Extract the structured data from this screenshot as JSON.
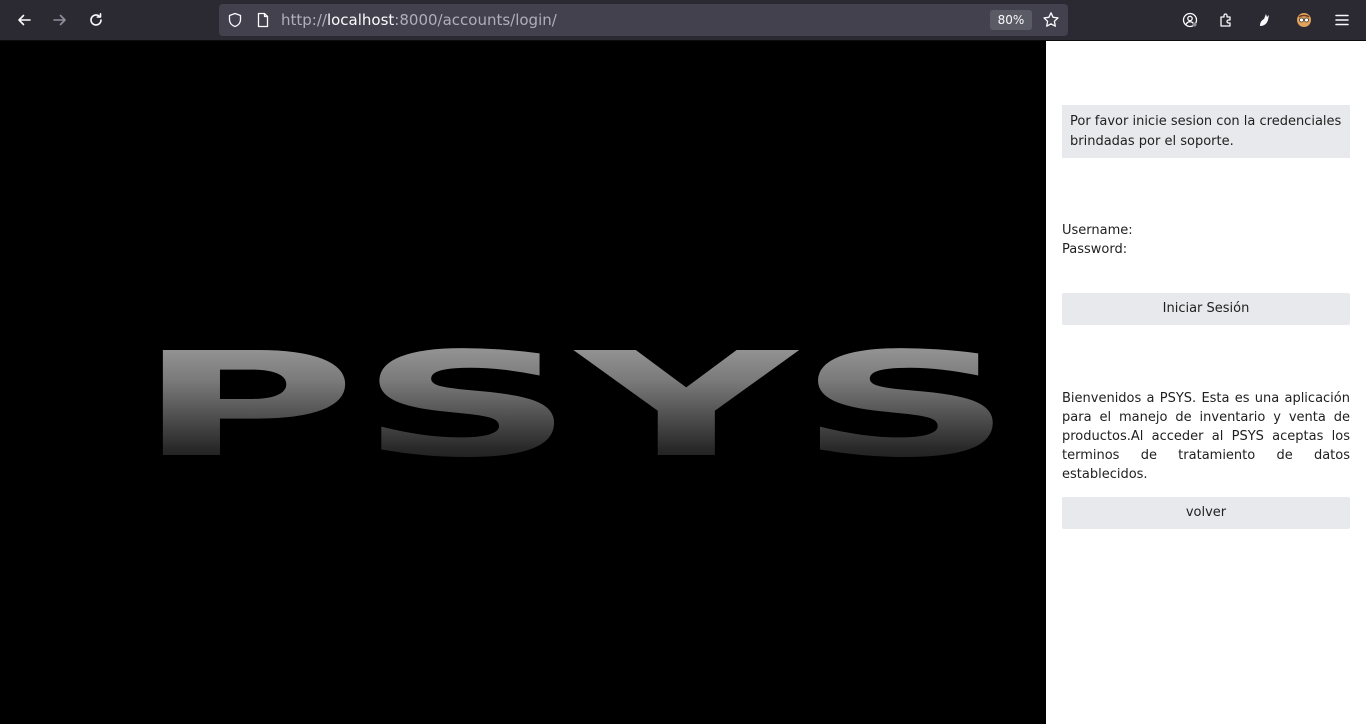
{
  "browser": {
    "url_prefix": "http://",
    "url_host": "localhost",
    "url_rest": ":8000/accounts/login/",
    "zoom": "80%",
    "icons": [
      "back-icon",
      "forward-icon",
      "reload-icon",
      "shield-icon",
      "page-icon",
      "star-icon",
      "account-icon",
      "extensions-icon",
      "extension-paw-icon",
      "extension-avatar-icon",
      "menu-icon"
    ]
  },
  "hero": {
    "logo_text": "PSYS"
  },
  "login": {
    "notice": "Por favor inicie sesion con la credenciales brindadas por el soporte.",
    "username_label": "Username:",
    "password_label": "Password:",
    "submit_label": "Iniciar Sesión",
    "welcome_text": "Bienvenidos a PSYS. Esta es una aplicación para el manejo de inventario y venta de productos.Al acceder al PSYS aceptas los terminos de tratamiento de datos establecidos.",
    "back_label": "volver"
  },
  "colors": {
    "toolbar_bg": "#2b2a33",
    "urlbar_bg": "#42414d",
    "button_bg": "#e8e9ec",
    "hero_bg": "#000000"
  }
}
